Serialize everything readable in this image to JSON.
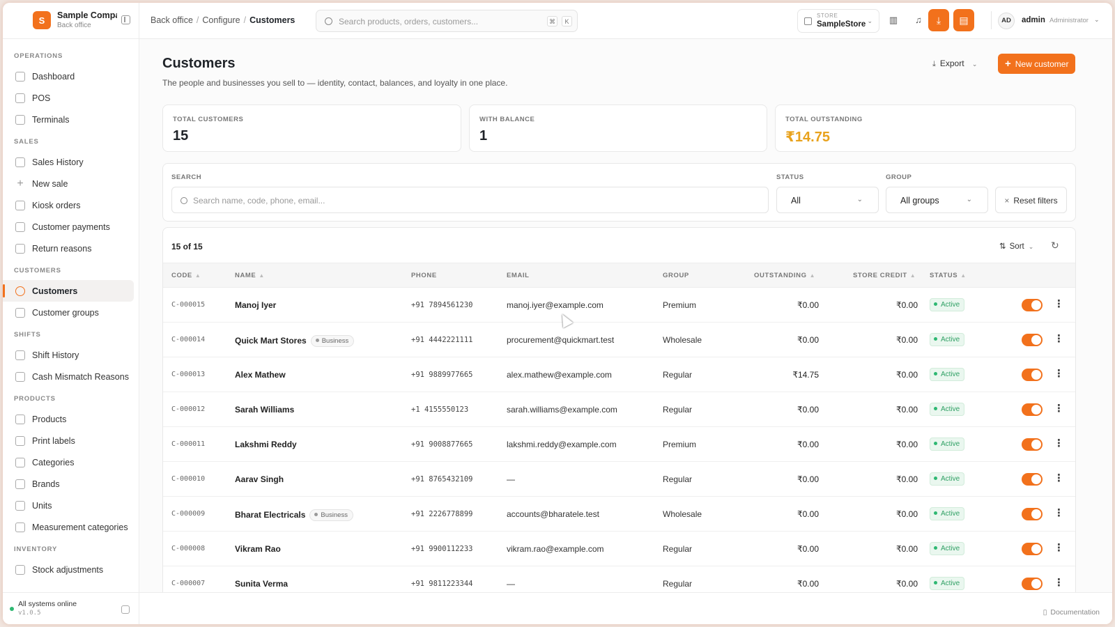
{
  "brand": {
    "logo_letter": "S",
    "name": "Sample Compa",
    "sub": "Back office"
  },
  "sidebar": {
    "sections": [
      {
        "title": "OPERATIONS",
        "items": [
          {
            "label": "Dashboard",
            "icon": "grid-icon"
          },
          {
            "label": "POS",
            "icon": "monitor-icon"
          },
          {
            "label": "Terminals",
            "icon": "terminal-icon"
          }
        ]
      },
      {
        "title": "SALES",
        "items": [
          {
            "label": "Sales History",
            "icon": "receipt-icon"
          },
          {
            "label": "New sale",
            "icon": "plus-icon"
          },
          {
            "label": "Kiosk orders",
            "icon": "kiosk-icon"
          },
          {
            "label": "Customer payments",
            "icon": "cash-icon"
          },
          {
            "label": "Return reasons",
            "icon": "undo-icon"
          }
        ]
      },
      {
        "title": "CUSTOMERS",
        "items": [
          {
            "label": "Customers",
            "icon": "users-icon",
            "active": true
          },
          {
            "label": "Customer groups",
            "icon": "dots-grid-icon"
          }
        ]
      },
      {
        "title": "SHIFTS",
        "items": [
          {
            "label": "Shift History",
            "icon": "clock-icon"
          },
          {
            "label": "Cash Mismatch Reasons",
            "icon": "bar-chart-icon"
          }
        ]
      },
      {
        "title": "PRODUCTS",
        "items": [
          {
            "label": "Products",
            "icon": "box-icon"
          },
          {
            "label": "Print labels",
            "icon": "barcode-icon"
          },
          {
            "label": "Categories",
            "icon": "list-tree-icon"
          },
          {
            "label": "Brands",
            "icon": "star-icon"
          },
          {
            "label": "Units",
            "icon": "dots-grid-icon"
          },
          {
            "label": "Measurement categories",
            "icon": "tag-icon"
          }
        ]
      },
      {
        "title": "INVENTORY",
        "items": [
          {
            "label": "Stock adjustments",
            "icon": "edit-icon"
          }
        ]
      }
    ],
    "footer": {
      "status": "All systems online",
      "version": "v1.0.5"
    }
  },
  "header": {
    "breadcrumb": [
      "Back office",
      "Configure",
      "Customers"
    ],
    "search_placeholder": "Search products, orders, customers...",
    "shortcut": [
      "⌘",
      "K"
    ],
    "store_label": "STORE",
    "store_name": "SampleStore",
    "user_initials": "AD",
    "user_name": "admin",
    "user_role": "Administrator"
  },
  "page": {
    "title": "Customers",
    "description": "The people and businesses you sell to — identity, contact, balances, and loyalty in one place.",
    "export_label": "Export",
    "new_label": "New customer"
  },
  "stats": [
    {
      "label": "TOTAL CUSTOMERS",
      "value": "15"
    },
    {
      "label": "WITH BALANCE",
      "value": "1"
    },
    {
      "label": "TOTAL OUTSTANDING",
      "value": "₹14.75"
    }
  ],
  "filters": {
    "search_label": "SEARCH",
    "search_placeholder": "Search name, code, phone, email...",
    "status_label": "STATUS",
    "status_value": "All",
    "group_label": "GROUP",
    "group_value": "All groups",
    "reset_label": "Reset filters"
  },
  "table": {
    "count": "15 of 15",
    "sort_label": "Sort",
    "columns": [
      "CODE",
      "NAME",
      "PHONE",
      "EMAIL",
      "GROUP",
      "OUTSTANDING",
      "STORE CREDIT",
      "STATUS"
    ],
    "rows": [
      {
        "code": "C-000015",
        "name": "Manoj Iyer",
        "tag": "",
        "phone": "+91 7894561230",
        "email": "manoj.iyer@example.com",
        "group": "Premium",
        "outstanding": "₹0.00",
        "credit": "₹0.00",
        "status": "Active"
      },
      {
        "code": "C-000014",
        "name": "Quick Mart Stores",
        "tag": "Business",
        "phone": "+91 4442221111",
        "email": "procurement@quickmart.test",
        "group": "Wholesale",
        "outstanding": "₹0.00",
        "credit": "₹0.00",
        "status": "Active"
      },
      {
        "code": "C-000013",
        "name": "Alex Mathew",
        "tag": "",
        "phone": "+91 9889977665",
        "email": "alex.mathew@example.com",
        "group": "Regular",
        "outstanding": "₹14.75",
        "credit": "₹0.00",
        "status": "Active"
      },
      {
        "code": "C-000012",
        "name": "Sarah Williams",
        "tag": "",
        "phone": "+1 4155550123",
        "email": "sarah.williams@example.com",
        "group": "Regular",
        "outstanding": "₹0.00",
        "credit": "₹0.00",
        "status": "Active"
      },
      {
        "code": "C-000011",
        "name": "Lakshmi Reddy",
        "tag": "",
        "phone": "+91 9008877665",
        "email": "lakshmi.reddy@example.com",
        "group": "Premium",
        "outstanding": "₹0.00",
        "credit": "₹0.00",
        "status": "Active"
      },
      {
        "code": "C-000010",
        "name": "Aarav Singh",
        "tag": "",
        "phone": "+91 8765432109",
        "email": "—",
        "group": "Regular",
        "outstanding": "₹0.00",
        "credit": "₹0.00",
        "status": "Active"
      },
      {
        "code": "C-000009",
        "name": "Bharat Electricals",
        "tag": "Business",
        "phone": "+91 2226778899",
        "email": "accounts@bharatele.test",
        "group": "Wholesale",
        "outstanding": "₹0.00",
        "credit": "₹0.00",
        "status": "Active"
      },
      {
        "code": "C-000008",
        "name": "Vikram Rao",
        "tag": "",
        "phone": "+91 9900112233",
        "email": "vikram.rao@example.com",
        "group": "Regular",
        "outstanding": "₹0.00",
        "credit": "₹0.00",
        "status": "Active"
      },
      {
        "code": "C-000007",
        "name": "Sunita Verma",
        "tag": "",
        "phone": "+91 9811223344",
        "email": "—",
        "group": "Regular",
        "outstanding": "₹0.00",
        "credit": "₹0.00",
        "status": "Active"
      }
    ]
  },
  "bottom": {
    "doc_label": "Documentation"
  },
  "colors": {
    "accent": "#f2711c",
    "warning": "#e8a21c",
    "success": "#2eb872"
  }
}
